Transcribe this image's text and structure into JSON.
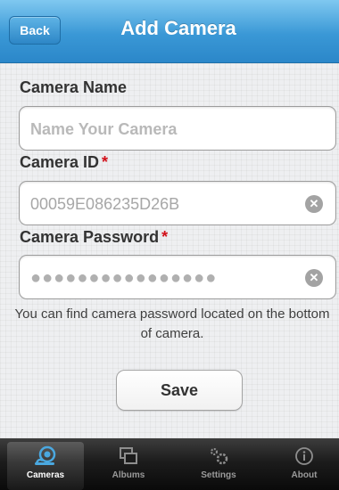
{
  "header": {
    "back_label": "Back",
    "title": "Add Camera"
  },
  "form": {
    "name": {
      "label": "Camera Name",
      "placeholder": "Name Your Camera"
    },
    "id": {
      "label": "Camera ID",
      "required_mark": "*",
      "value": "00059E086235D26B"
    },
    "password": {
      "label": "Camera Password",
      "required_mark": "*",
      "value": "●●●●●●●●●●●●●●●●"
    },
    "hint": "You can find camera password located on the bottom of camera.",
    "save_label": "Save"
  },
  "tabbar": {
    "active_tab": "Cameras",
    "tabs": [
      {
        "label": "Cameras",
        "icon": "camera-icon"
      },
      {
        "label": "Albums",
        "icon": "albums-icon"
      },
      {
        "label": "Settings",
        "icon": "gears-icon"
      },
      {
        "label": "About",
        "icon": "info-icon"
      }
    ]
  },
  "colors": {
    "nav_blue": "#3a98d6",
    "required_red": "#d2101a",
    "active_icon": "#4aa8e0"
  }
}
